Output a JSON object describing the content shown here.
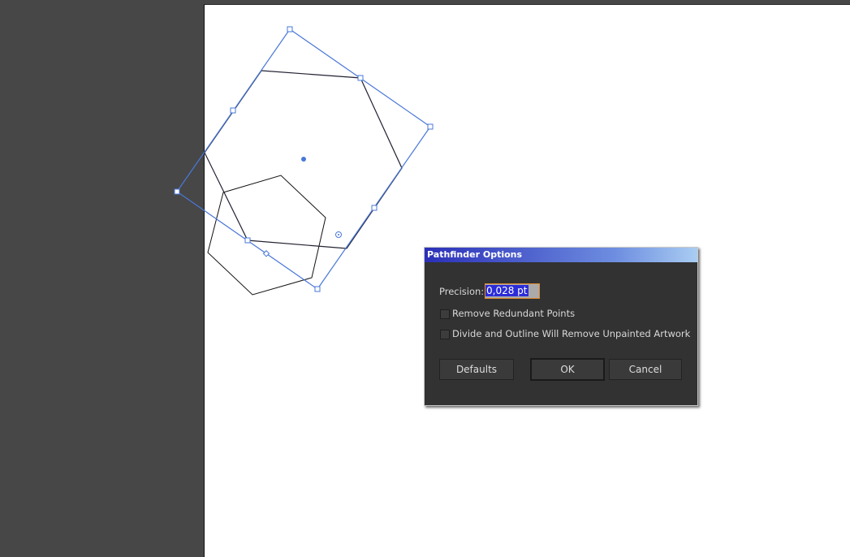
{
  "dialog": {
    "title": "Pathfinder Options",
    "precision_label": "Precision:",
    "precision_value": "0,028 pt",
    "checkbox_remove_redundant": {
      "label": "Remove Redundant Points",
      "checked": false
    },
    "checkbox_divide_outline": {
      "label": "Divide and Outline Will Remove Unpainted Artwork",
      "checked": false
    },
    "buttons": {
      "defaults": "Defaults",
      "ok": "OK",
      "cancel": "Cancel"
    }
  },
  "colors": {
    "selection": "#4a78d8",
    "canvas": "#474747",
    "artboard": "#ffffff"
  }
}
